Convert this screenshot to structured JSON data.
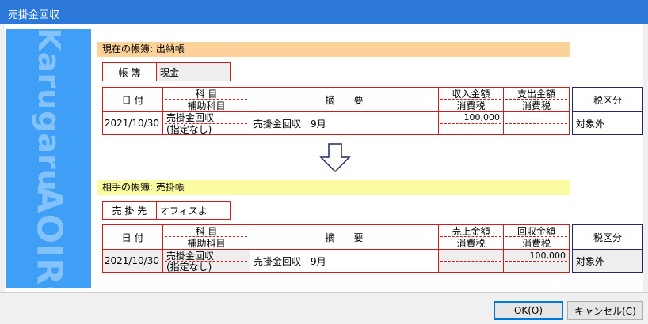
{
  "window": {
    "title": "売掛金回収"
  },
  "sidebar": {
    "brand_top": "Karugaru",
    "brand_bottom": "AOIRO"
  },
  "current_book": {
    "heading": "現在の帳簿: 出納帳",
    "book_label": "帳 簿",
    "book_value": "現金",
    "columns": {
      "date": "日 付",
      "subject": "科 目",
      "sub_subject": "補助科目",
      "summary": "摘　　要",
      "amount1": "収入金額",
      "tax1": "消費税",
      "amount2": "支出金額",
      "tax2": "消費税",
      "tax_class": "税区分"
    },
    "row": {
      "date": "2021/10/30",
      "subject": "売掛金回収",
      "sub_subject": "(指定なし)",
      "summary": "売掛金回収　9月",
      "amount1": "100,000",
      "tax1": "",
      "amount2": "",
      "tax2": "",
      "tax_class": "対象外"
    }
  },
  "arrow": {
    "icon": "down-arrow-icon"
  },
  "partner_book": {
    "heading": "相手の帳簿: 売掛帳",
    "book_label": "売 掛 先",
    "book_value": "オフィスよ",
    "columns": {
      "date": "日 付",
      "subject": "科 目",
      "sub_subject": "補助科目",
      "summary": "摘　　要",
      "amount1": "売上金額",
      "tax1": "消費税",
      "amount2": "回収金額",
      "tax2": "消費税",
      "tax_class": "税区分"
    },
    "row": {
      "date": "2021/10/30",
      "subject": "売掛金回収",
      "sub_subject": "(指定なし)",
      "summary": "売掛金回収　9月",
      "amount1": "",
      "tax1": "",
      "amount2": "100,000",
      "tax2": "",
      "tax_class": "対象外"
    }
  },
  "buttons": {
    "ok": "OK(O)",
    "cancel": "キャンセル(C)"
  },
  "colors": {
    "titlebar": "#2b78d9",
    "sidebar": "#3f9ef5",
    "grid": "#d41a1a",
    "band_current": "#fcd19a",
    "band_partner": "#fbfca2"
  }
}
